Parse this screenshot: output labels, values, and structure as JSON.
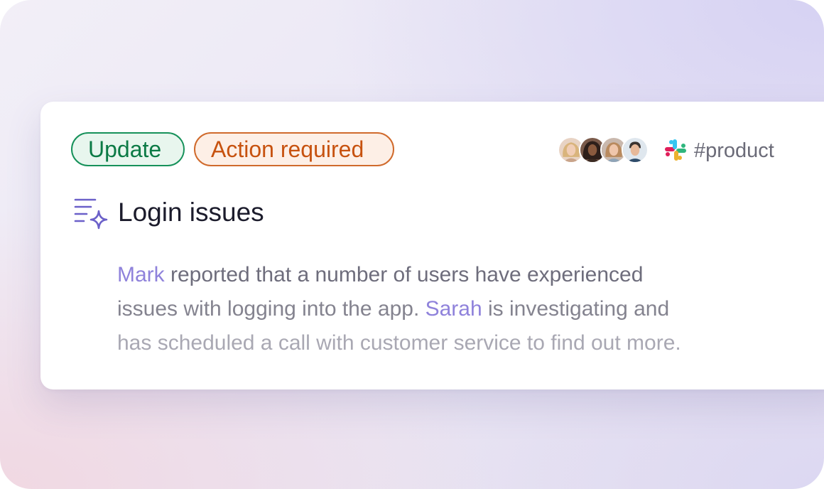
{
  "card": {
    "tags": {
      "update": "Update",
      "action": "Action required"
    },
    "channel": "#product",
    "title": "Login issues",
    "summary": {
      "line1": {
        "mention": "Mark",
        "text": " reported that a number of users have experienced"
      },
      "line2": {
        "text_before": "issues with logging into the app. ",
        "mention": "Sarah",
        "text_after": " is investigating and"
      },
      "line3": {
        "text": "has scheduled a call with customer service to find out more."
      }
    }
  },
  "icons": {
    "title_icon": "ai-summary-sparkle-icon",
    "channel_icon": "slack-icon"
  },
  "colors": {
    "update_tag": "#16915a",
    "action_tag": "#d06a2c",
    "mention": "#8f82db",
    "title": "#1c1c2c"
  }
}
